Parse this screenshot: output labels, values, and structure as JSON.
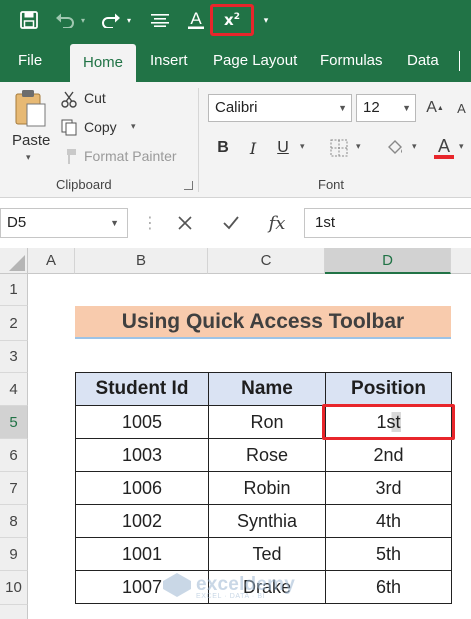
{
  "colors": {
    "ribbon_green": "#217346",
    "highlight_red": "#e8262b",
    "title_fill": "#f8cbad",
    "header_fill": "#dae3f3"
  },
  "quick_access": {
    "icons": [
      "save-icon",
      "undo-icon",
      "redo-icon",
      "align-icon",
      "font-color-icon",
      "superscript-icon",
      "customize-icon"
    ]
  },
  "tabs": [
    "File",
    "Home",
    "Insert",
    "Page Layout",
    "Formulas",
    "Data"
  ],
  "active_tab": "Home",
  "clipboard": {
    "paste": "Paste",
    "cut": "Cut",
    "copy": "Copy",
    "format_painter": "Format Painter",
    "label": "Clipboard"
  },
  "font": {
    "name": "Calibri",
    "size": "12",
    "label": "Font",
    "bold": "B",
    "italic": "I",
    "underline": "U"
  },
  "formula_bar": {
    "name_box": "D5",
    "fx": "fx",
    "value": "1st"
  },
  "columns": [
    "A",
    "B",
    "C",
    "D"
  ],
  "selected_column": "D",
  "rows": [
    "1",
    "2",
    "3",
    "4",
    "5",
    "6",
    "7",
    "8",
    "9",
    "10"
  ],
  "selected_row": "5",
  "sheet": {
    "title": "Using Quick Access Toolbar",
    "headers": [
      "Student Id",
      "Name",
      "Position"
    ],
    "rows": [
      {
        "id": "1005",
        "name": "Ron",
        "position": "1st"
      },
      {
        "id": "1003",
        "name": "Rose",
        "position": "2nd"
      },
      {
        "id": "1006",
        "name": "Robin",
        "position": "3rd"
      },
      {
        "id": "1002",
        "name": "Synthia",
        "position": "4th"
      },
      {
        "id": "1001",
        "name": "Ted",
        "position": "5th"
      },
      {
        "id": "1007",
        "name": "Drake",
        "position": "6th"
      }
    ]
  },
  "watermark": {
    "name": "exceldemy",
    "tagline": "EXCEL · DATA · BI"
  }
}
